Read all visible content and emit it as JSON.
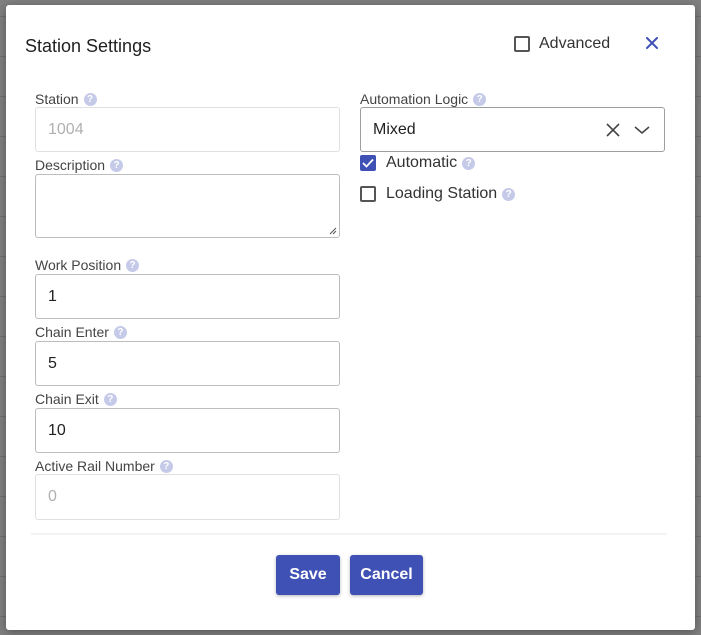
{
  "dialog": {
    "title": "Station Settings",
    "advanced_label": "Advanced",
    "advanced_checked": false
  },
  "fields": {
    "station": {
      "label": "Station",
      "placeholder": "1004",
      "value": ""
    },
    "description": {
      "label": "Description",
      "value": ""
    },
    "work_position": {
      "label": "Work Position",
      "value": "1"
    },
    "chain_enter": {
      "label": "Chain Enter",
      "value": "5"
    },
    "chain_exit": {
      "label": "Chain Exit",
      "value": "10"
    },
    "active_rail_number": {
      "label": "Active Rail Number",
      "placeholder": "0",
      "value": ""
    },
    "automation_logic": {
      "label": "Automation Logic",
      "value": "Mixed"
    }
  },
  "checkboxes": {
    "automatic": {
      "label": "Automatic",
      "checked": true
    },
    "loading_station": {
      "label": "Loading Station",
      "checked": false
    }
  },
  "help_glyph": "?",
  "buttons": {
    "save": "Save",
    "cancel": "Cancel"
  },
  "colors": {
    "primary": "#3f51b5",
    "help": "#c5cae9"
  }
}
